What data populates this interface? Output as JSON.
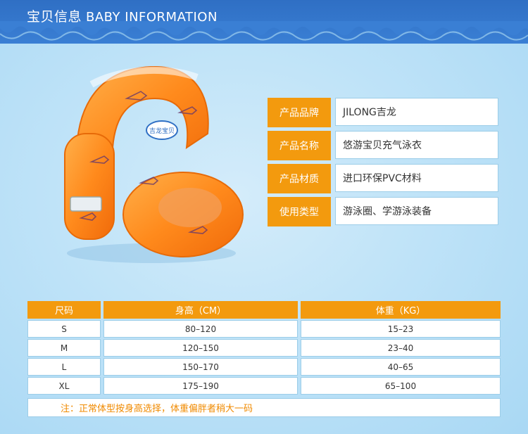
{
  "banner": {
    "title_cn": "宝贝信息",
    "title_en": "BABY INFORMATION",
    "color": "#2f6fc4"
  },
  "product": {
    "image": "orange-inflatable-swim-vest-illustration",
    "label_text": "吉龙宝贝"
  },
  "info": [
    {
      "label": "产品品牌",
      "value": "JILONG吉龙"
    },
    {
      "label": "产品名称",
      "value": "悠游宝贝充气泳衣"
    },
    {
      "label": "产品材质",
      "value": "进口环保PVC材料"
    },
    {
      "label": "使用类型",
      "value": "游泳圈、学游泳装备"
    }
  ],
  "size_table": {
    "headers": [
      "尺码",
      "身高（CM）",
      "体重（KG）"
    ],
    "rows": [
      [
        "S",
        "80–120",
        "15–23"
      ],
      [
        "M",
        "120–150",
        "23–40"
      ],
      [
        "L",
        "150–170",
        "40–65"
      ],
      [
        "XL",
        "175–190",
        "65–100"
      ]
    ],
    "note": "注：正常体型按身高选择，体重偏胖者稍大一码"
  },
  "colors": {
    "accent": "#f39a0e",
    "border": "#9ccde8",
    "note": "#f08a00"
  }
}
